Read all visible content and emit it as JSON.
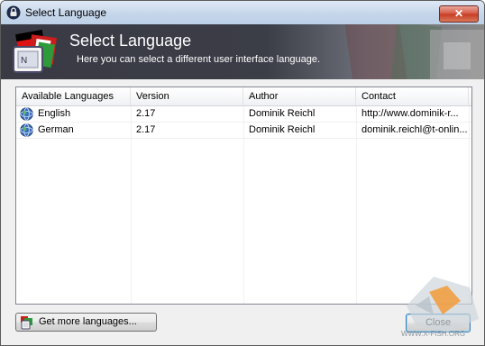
{
  "window": {
    "title": "Select Language",
    "close_glyph": "✕"
  },
  "banner": {
    "title": "Select Language",
    "subtitle": "Here you can select a different user interface language."
  },
  "table": {
    "columns": [
      "Available Languages",
      "Version",
      "Author",
      "Contact"
    ],
    "rows": [
      {
        "language": "English",
        "version": "2.17",
        "author": "Dominik Reichl",
        "contact": "http://www.dominik-r...",
        "icon": "globe-icon"
      },
      {
        "language": "German",
        "version": "2.17",
        "author": "Dominik Reichl",
        "contact": "dominik.reichl@t-onlin...",
        "icon": "globe-icon"
      }
    ]
  },
  "buttons": {
    "get_more": "Get more languages...",
    "close": "Close"
  },
  "watermark": {
    "text": "WWW.X-FISH.ORG"
  },
  "colors": {
    "banner_bg": "#3b3d47",
    "close_red": "#c63b22",
    "selection_blue": "#3c7fb1"
  }
}
